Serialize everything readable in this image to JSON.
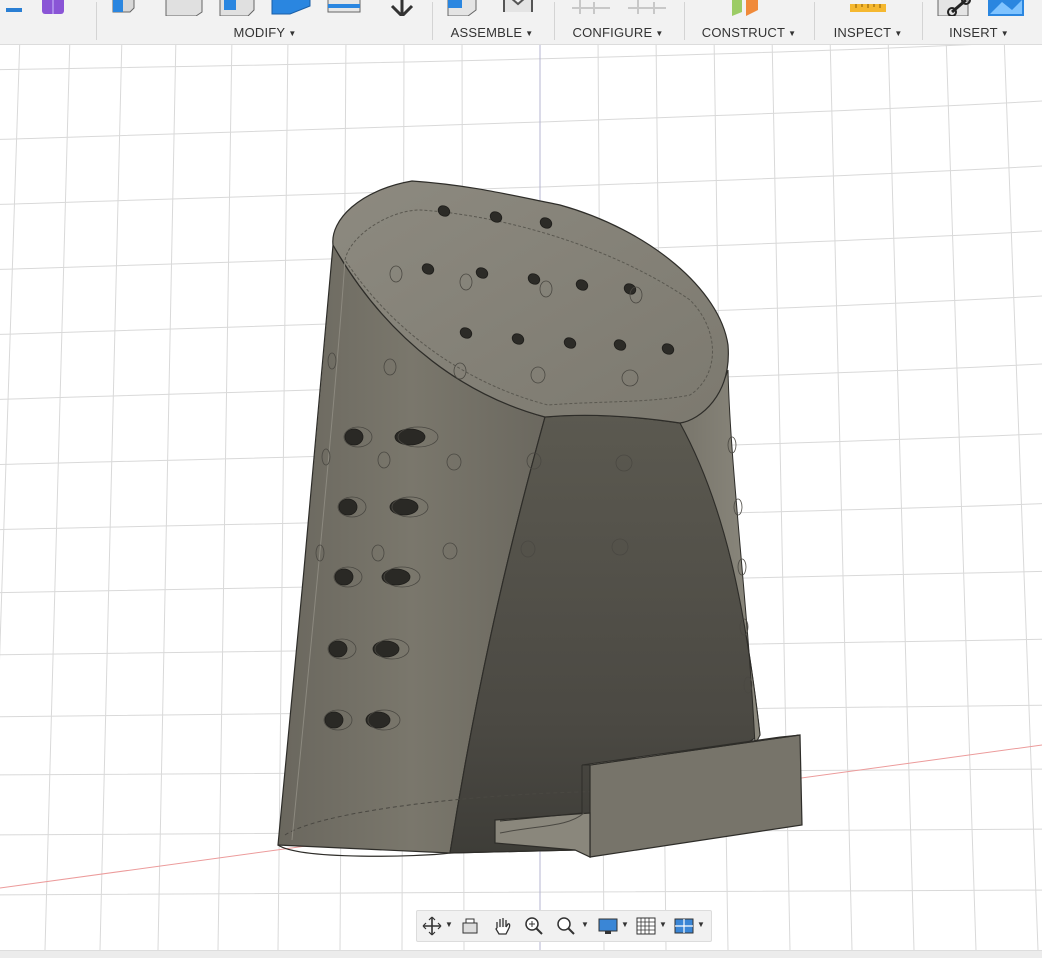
{
  "toolbar": {
    "groups": [
      {
        "id": "modify",
        "label": "MODIFY"
      },
      {
        "id": "assemble",
        "label": "ASSEMBLE"
      },
      {
        "id": "configure",
        "label": "CONFIGURE"
      },
      {
        "id": "construct",
        "label": "CONSTRUCT"
      },
      {
        "id": "inspect",
        "label": "INSPECT"
      },
      {
        "id": "insert",
        "label": "INSERT"
      }
    ]
  },
  "navbar": {
    "tools": [
      "orbit-icon",
      "look-at-icon",
      "pan-icon",
      "zoom-icon",
      "fit-icon",
      "display-settings-icon",
      "grid-icon",
      "viewports-icon"
    ]
  },
  "colors": {
    "toolbar_bg": "#f2f2f2",
    "model_body": "#6d6a60",
    "model_dark": "#4d4b44",
    "model_light": "#8a867b",
    "grid": "#d7d7d7",
    "axis_red": "#e58a8a",
    "axis_blue": "#8e8ed8"
  }
}
